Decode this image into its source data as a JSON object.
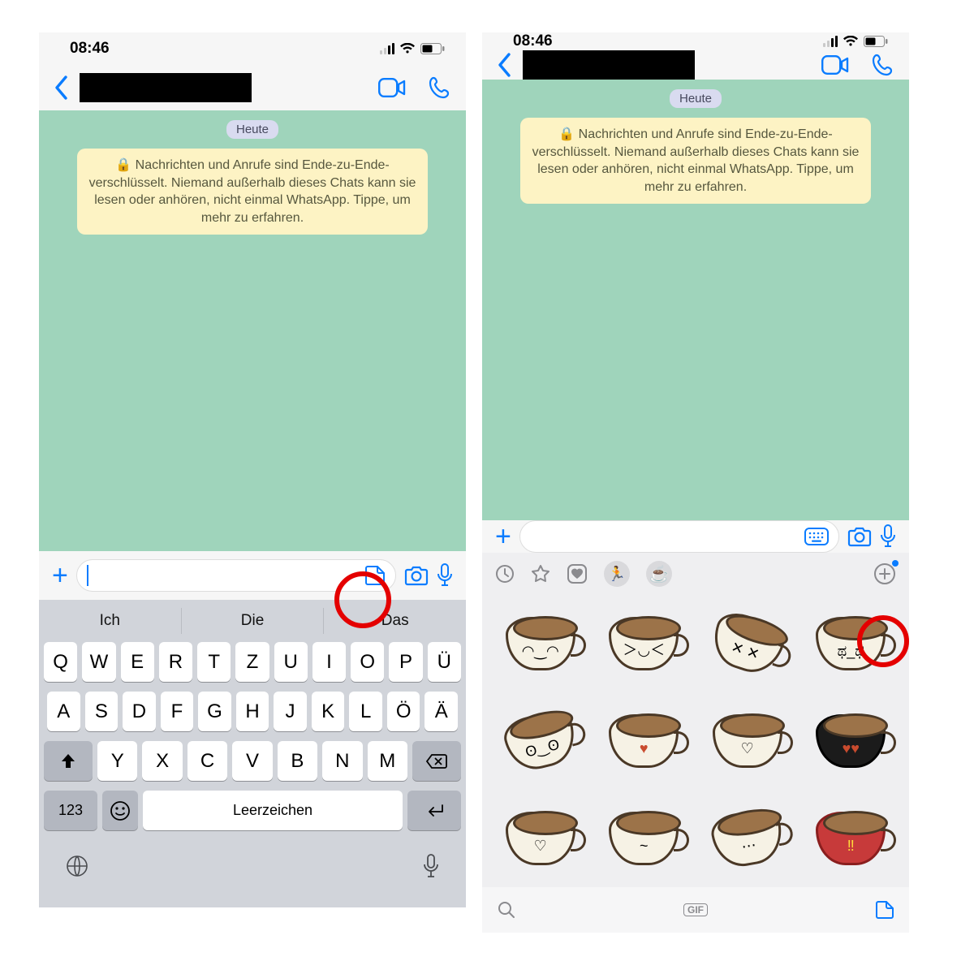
{
  "status": {
    "time": "08:46"
  },
  "chat": {
    "datePill": "Heute",
    "encryption": "Nachrichten und Anrufe sind Ende-zu-Ende-verschlüsselt. Niemand außerhalb dieses Chats kann sie lesen oder anhören, nicht einmal WhatsApp. Tippe, um mehr zu erfahren."
  },
  "keyboard": {
    "suggestions": [
      "Ich",
      "Die",
      "Das"
    ],
    "row1": [
      "Q",
      "W",
      "E",
      "R",
      "T",
      "Z",
      "U",
      "I",
      "O",
      "P",
      "Ü"
    ],
    "row2": [
      "A",
      "S",
      "D",
      "F",
      "G",
      "H",
      "J",
      "K",
      "L",
      "Ö",
      "Ä"
    ],
    "row3": [
      "Y",
      "X",
      "C",
      "V",
      "B",
      "N",
      "M"
    ],
    "numKey": "123",
    "space": "Leerzeichen"
  },
  "stickers": {
    "gifLabel": "GIF",
    "faces": [
      "◠‿◠",
      "＞◡＜",
      "✕ ✕",
      "ಥ_ಥ",
      "ʘ‿ʘ",
      "♥",
      "♡",
      "♥♥",
      "♡",
      "~",
      "⋯",
      "‼"
    ]
  }
}
